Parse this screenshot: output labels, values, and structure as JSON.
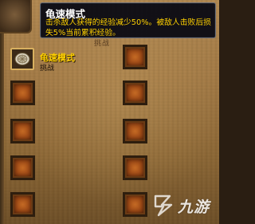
{
  "tooltip": {
    "title": "龟速模式",
    "description": "击杀敌人获得的经验减少50%。被敌人击败后损失5%当前累积经验。"
  },
  "header": {
    "partial_text": "挑战"
  },
  "challenge_list": {
    "active": {
      "name": "龟速模式",
      "subtitle": "挑战",
      "icon": "turtle-shell-icon"
    },
    "slot_count": 10
  },
  "watermark": {
    "text": "九游",
    "icon": "jiuyou-logo-icon"
  },
  "colors": {
    "tooltip_title": "#ffffff",
    "tooltip_text": "#ffd100",
    "active_name": "#ffd100"
  }
}
